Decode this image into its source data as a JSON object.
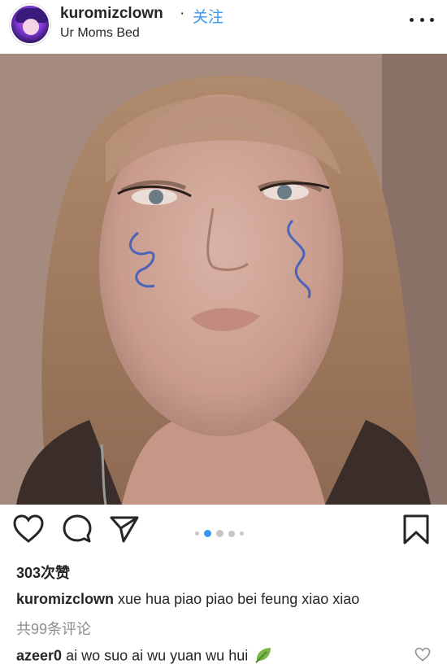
{
  "post": {
    "username": "kuromizclown",
    "separator": "·",
    "follow_label": "关注",
    "location": "Ur Moms Bed"
  },
  "carousel": {
    "count": 5,
    "active_index": 1
  },
  "likes_text": "303次赞",
  "caption": {
    "username": "kuromizclown",
    "text": "xue hua piao piao bei feung xiao xiao"
  },
  "view_comments": "共99条评论",
  "top_comment": {
    "username": "azeer0",
    "text": "ai wo suo ai wu yuan wu hui"
  },
  "icons": {
    "like": "heart-icon",
    "comment": "comment-bubble-icon",
    "share": "paper-plane-icon",
    "save": "bookmark-icon",
    "more": "more-dots-icon",
    "comment_like": "heart-outline-icon",
    "emoji": "leaf-emoji-icon"
  },
  "colors": {
    "link": "#3897f0",
    "text": "#262626",
    "muted": "#8e8e8e"
  }
}
